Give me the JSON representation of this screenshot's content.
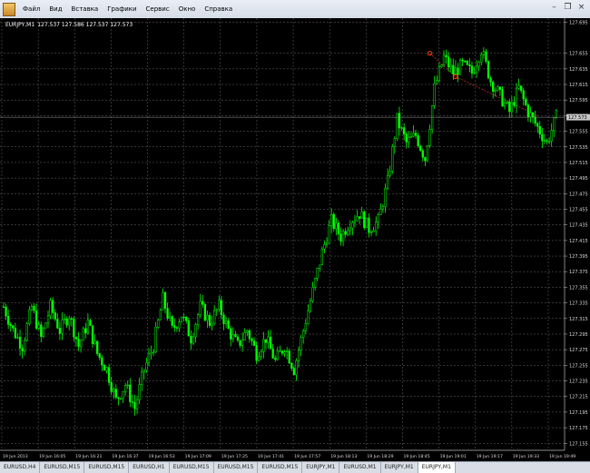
{
  "menu": {
    "items": [
      "Файл",
      "Вид",
      "Вставка",
      "Графики",
      "Сервис",
      "Окно",
      "Справка"
    ]
  },
  "chart_info": {
    "symbol": "EURJPY,M1",
    "ohlc": "127.537 127.586 127.537 127.573"
  },
  "tabs": [
    {
      "label": "EURUSD,H4",
      "active": false
    },
    {
      "label": "EURUSD,M15",
      "active": false
    },
    {
      "label": "EURUSD,M15",
      "active": false
    },
    {
      "label": "EURUSD,H1",
      "active": false
    },
    {
      "label": "EURUSD,M15",
      "active": false
    },
    {
      "label": "EURUSD,M15",
      "active": false
    },
    {
      "label": "EURUSD,M15",
      "active": false
    },
    {
      "label": "EURJPY,M1",
      "active": false
    },
    {
      "label": "EURUSD,M1",
      "active": false
    },
    {
      "label": "EURJPY,M1",
      "active": false
    },
    {
      "label": "EURJPY,M1",
      "active": true
    }
  ],
  "colors": {
    "background": "#000000",
    "candle": "#00ff00",
    "grid": "#6a6a6a",
    "price_label_bg": "#c8c8c8",
    "trend_line": "#c83232",
    "arrow_marker": "#ff3c00"
  },
  "chart_data": {
    "type": "candlestick",
    "symbol": "EURJPY",
    "timeframe": "M1",
    "current_price": 127.573,
    "current_price_label": "127.573",
    "y_ticks": [
      "127.695",
      "127.655",
      "127.635",
      "127.615",
      "127.595",
      "127.575",
      "127.555",
      "127.535",
      "127.515",
      "127.495",
      "127.475",
      "127.455",
      "127.435",
      "127.415",
      "127.395",
      "127.375",
      "127.355",
      "127.335",
      "127.315",
      "127.295",
      "127.275",
      "127.255",
      "127.235",
      "127.215",
      "127.195",
      "127.175",
      "127.155"
    ],
    "x_ticks": [
      "19 Jun 2013",
      "19 Jun 16:05",
      "19 Jun 16:21",
      "19 Jun 16:37",
      "19 Jun 16:53",
      "19 Jun 17:09",
      "19 Jun 17:25",
      "19 Jun 17:41",
      "19 Jun 17:57",
      "19 Jun 18:13",
      "19 Jun 18:29",
      "19 Jun 18:45",
      "19 Jun 19:01",
      "19 Jun 19:17",
      "19 Jun 19:33",
      "19 Jun 19:49"
    ],
    "ylim": [
      127.146,
      127.7
    ],
    "x_range_minutes": [
      0,
      238
    ],
    "grid": true,
    "close_path": [
      [
        0,
        127.33
      ],
      [
        4,
        127.3
      ],
      [
        8,
        127.28
      ],
      [
        12,
        127.33
      ],
      [
        16,
        127.29
      ],
      [
        20,
        127.33
      ],
      [
        24,
        127.3
      ],
      [
        28,
        127.32
      ],
      [
        32,
        127.28
      ],
      [
        36,
        127.31
      ],
      [
        40,
        127.27
      ],
      [
        44,
        127.25
      ],
      [
        48,
        127.21
      ],
      [
        52,
        127.23
      ],
      [
        56,
        127.2
      ],
      [
        60,
        127.25
      ],
      [
        64,
        127.28
      ],
      [
        68,
        127.34
      ],
      [
        72,
        127.3
      ],
      [
        76,
        127.32
      ],
      [
        80,
        127.29
      ],
      [
        84,
        127.33
      ],
      [
        88,
        127.31
      ],
      [
        92,
        127.33
      ],
      [
        96,
        127.3
      ],
      [
        100,
        127.28
      ],
      [
        104,
        127.3
      ],
      [
        108,
        127.27
      ],
      [
        112,
        127.29
      ],
      [
        116,
        127.26
      ],
      [
        120,
        127.28
      ],
      [
        124,
        127.25
      ],
      [
        128,
        127.3
      ],
      [
        132,
        127.35
      ],
      [
        136,
        127.4
      ],
      [
        140,
        127.44
      ],
      [
        144,
        127.42
      ],
      [
        148,
        127.44
      ],
      [
        152,
        127.45
      ],
      [
        156,
        127.43
      ],
      [
        160,
        127.44
      ],
      [
        164,
        127.49
      ],
      [
        168,
        127.57
      ],
      [
        172,
        127.54
      ],
      [
        176,
        127.55
      ],
      [
        180,
        127.52
      ],
      [
        184,
        127.61
      ],
      [
        188,
        127.65
      ],
      [
        192,
        127.63
      ],
      [
        196,
        127.64
      ],
      [
        200,
        127.63
      ],
      [
        204,
        127.66
      ],
      [
        208,
        127.62
      ],
      [
        212,
        127.6
      ],
      [
        216,
        127.58
      ],
      [
        220,
        127.61
      ],
      [
        224,
        127.58
      ],
      [
        228,
        127.56
      ],
      [
        232,
        127.54
      ],
      [
        236,
        127.573
      ]
    ],
    "markers": [
      {
        "t": 182,
        "y": 127.655,
        "kind": "arrow"
      },
      {
        "t": 193,
        "y": 127.625,
        "kind": "arrow"
      }
    ],
    "trend_lines": [
      {
        "from": [
          182,
          127.655
        ],
        "to": [
          193,
          127.625
        ]
      },
      {
        "from": [
          193,
          127.625
        ],
        "to": [
          228,
          127.575
        ]
      }
    ]
  }
}
